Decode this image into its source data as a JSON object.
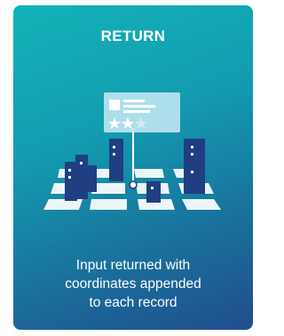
{
  "card": {
    "title": "RETURN",
    "description_lines": [
      "Input returned with",
      "coordinates appended",
      "to each record"
    ],
    "colors": {
      "gradient_start": "#13b3b8",
      "gradient_end": "#204e8c",
      "building": "#1f3f82",
      "tile": "#ffffff",
      "popup": "#bfe6f2"
    },
    "illustration": {
      "icon": "map-location-result-icon",
      "rating_stars_filled": 2,
      "rating_stars_total": 3
    }
  }
}
